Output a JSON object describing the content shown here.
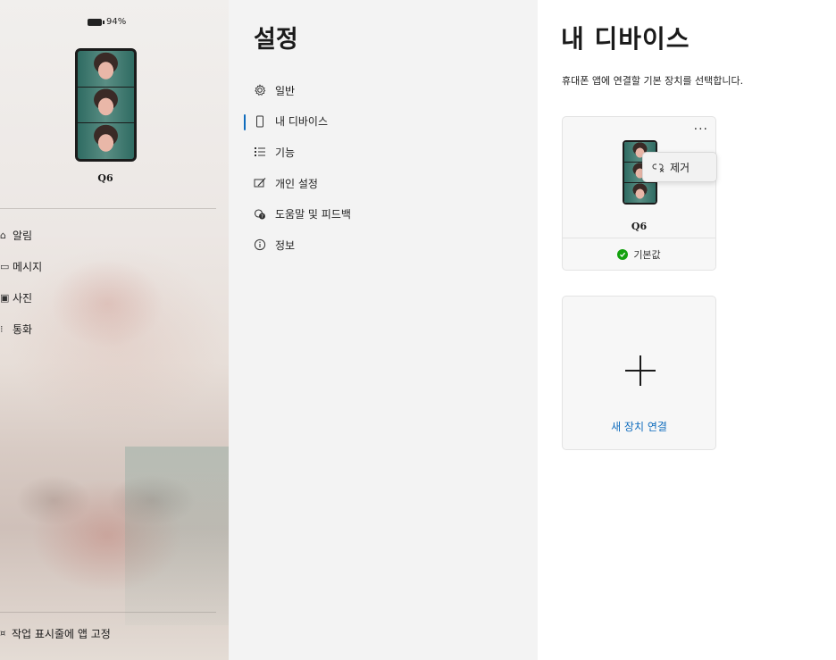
{
  "phone_panel": {
    "battery": "94%",
    "device_name": "Q6",
    "nav": [
      {
        "icon": "bell-icon",
        "label": "알림"
      },
      {
        "icon": "message-icon",
        "label": "메시지"
      },
      {
        "icon": "photo-icon",
        "label": "사진"
      },
      {
        "icon": "call-icon",
        "label": "통화"
      }
    ],
    "pin_label": "작업 표시줄에 앱 고정"
  },
  "settings": {
    "title": "설정",
    "items": [
      {
        "icon": "gear-icon",
        "label": "일반"
      },
      {
        "icon": "phone-icon",
        "label": "내 디바이스",
        "active": true
      },
      {
        "icon": "features-list-icon",
        "label": "기능"
      },
      {
        "icon": "personalize-icon",
        "label": "개인 설정"
      },
      {
        "icon": "feedback-icon",
        "label": "도움말 및 피드백"
      },
      {
        "icon": "info-icon",
        "label": "정보"
      }
    ]
  },
  "devices": {
    "title": "내 디바이스",
    "subtitle": "휴대폰 앱에 연결할 기본 장치를 선택합니다.",
    "card": {
      "more_label": "···",
      "device_name": "Q6",
      "default_label": "기본값",
      "context_menu": {
        "remove_label": "제거"
      }
    },
    "add_card": {
      "label": "새 장치 연결"
    }
  },
  "colors": {
    "accent": "#0f6cbd",
    "success": "#13a10e"
  }
}
